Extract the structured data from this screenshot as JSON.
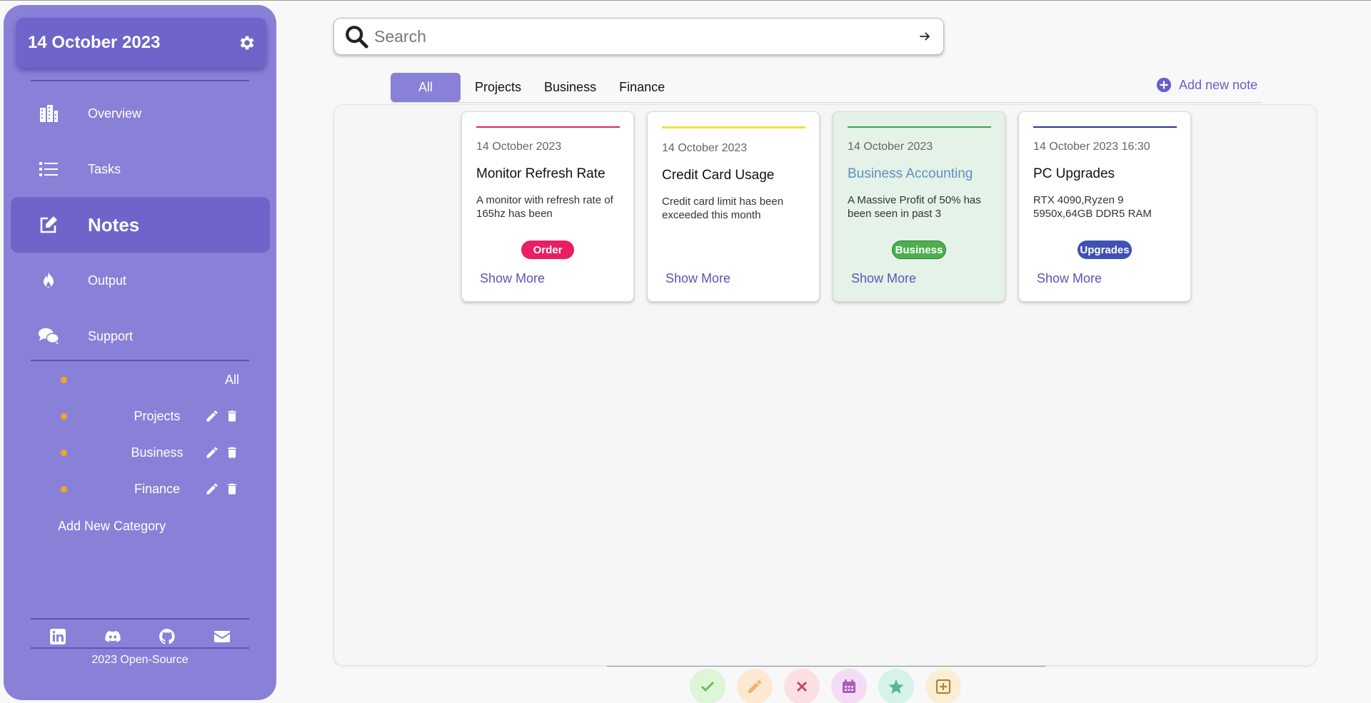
{
  "sidebar": {
    "date": "14 October 2023",
    "nav": [
      {
        "label": "Overview",
        "icon": "building-icon"
      },
      {
        "label": "Tasks",
        "icon": "list-icon"
      },
      {
        "label": "Notes",
        "icon": "edit-note-icon",
        "active": true
      },
      {
        "label": "Output",
        "icon": "fire-icon"
      },
      {
        "label": "Support",
        "icon": "chat-icon"
      }
    ],
    "categories": [
      {
        "label": "All"
      },
      {
        "label": "Projects"
      },
      {
        "label": "Business"
      },
      {
        "label": "Finance"
      }
    ],
    "add_category": "Add New Category",
    "socials": [
      "linkedin-icon",
      "discord-icon",
      "github-icon",
      "mail-icon"
    ],
    "footer": "2023 Open-Source"
  },
  "search": {
    "placeholder": "Search"
  },
  "tabs": [
    {
      "label": "All",
      "active": true
    },
    {
      "label": "Projects"
    },
    {
      "label": "Business"
    },
    {
      "label": "Finance"
    }
  ],
  "add_note": "Add new note",
  "cards": [
    {
      "date": "14 October 2023",
      "title": "Monitor Refresh Rate",
      "body": "A monitor with refresh rate of 165hz has been",
      "badge": "Order",
      "badge_color": "#e91e63",
      "accent": "#e0245e",
      "more": "Show More"
    },
    {
      "date": "14 October 2023",
      "title": "Credit Card Usage",
      "body": "Credit card limit has been exceeded this month",
      "badge": "",
      "accent": "#f5e03a",
      "more": "Show More"
    },
    {
      "date": "14 October 2023",
      "title": "Business Accounting",
      "body": "A Massive Profit of 50% has been seen in past 3",
      "badge": "Business",
      "badge_color": "#4caf50",
      "accent": "#43a047",
      "more": "Show More"
    },
    {
      "date": "14 October 2023 16:30",
      "title": "PC Upgrades",
      "body": "RTX 4090,Ryzen 9 5950x,64GB DDR5 RAM",
      "badge": "Upgrades",
      "badge_color": "#3f51b5",
      "accent": "#283593",
      "more": "Show More"
    }
  ],
  "toolbar": [
    {
      "icon": "check-icon",
      "bg": "#dff5d8",
      "fg": "#6cbf58"
    },
    {
      "icon": "pencil-icon",
      "bg": "#fde9d2",
      "fg": "#f0b46a"
    },
    {
      "icon": "close-icon",
      "bg": "#fbe0e3",
      "fg": "#c24a5a"
    },
    {
      "icon": "calendar-icon",
      "bg": "#f5dcf6",
      "fg": "#a65fb6"
    },
    {
      "icon": "star-icon",
      "bg": "#d6f2ea",
      "fg": "#55b89a"
    },
    {
      "icon": "add-box-icon",
      "bg": "#fbefd3",
      "fg": "#b0833a"
    }
  ]
}
